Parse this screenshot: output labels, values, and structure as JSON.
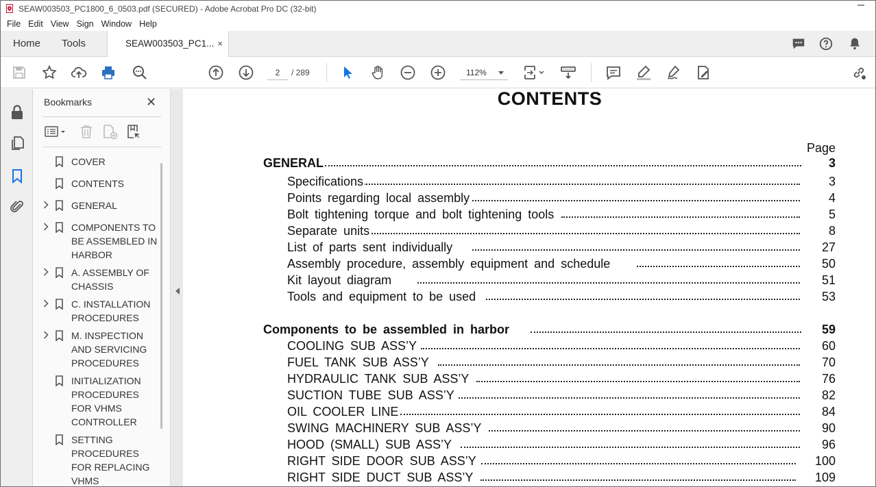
{
  "window": {
    "title": "SEAW003503_PC1800_6_0503.pdf (SECURED) - Adobe Acrobat Pro DC (32-bit)"
  },
  "menu": [
    "File",
    "Edit",
    "View",
    "Sign",
    "Window",
    "Help"
  ],
  "tabs": {
    "home": "Home",
    "tools": "Tools",
    "document": "SEAW003503_PC1...",
    "close": "×"
  },
  "toolbar": {
    "current_page": "2",
    "page_total": "/ 289",
    "zoom": "112%"
  },
  "bookmarks": {
    "title": "Bookmarks",
    "close": "✕",
    "items": [
      {
        "label": "COVER",
        "expandable": false
      },
      {
        "label": "CONTENTS",
        "expandable": false
      },
      {
        "label": "GENERAL",
        "expandable": true
      },
      {
        "label": "COMPONENTS TO BE ASSEMBLED IN HARBOR",
        "expandable": true
      },
      {
        "label": "A. ASSEMBLY OF CHASSIS",
        "expandable": true
      },
      {
        "label": "C. INSTALLATION PROCEDURES",
        "expandable": true
      },
      {
        "label": "M. INSPECTION AND SERVICING PROCEDURES",
        "expandable": true
      },
      {
        "label": "INITIALIZATION PROCEDURES FOR VHMS CONTROLLER",
        "expandable": false
      },
      {
        "label": "SETTING PROCEDURES FOR REPLACING VHMS",
        "expandable": false
      }
    ]
  },
  "document": {
    "title": "CONTENTS",
    "page_header": "Page",
    "toc": [
      {
        "text": "GENERAL",
        "page": "3",
        "level": 0
      },
      {
        "text": "Specifications",
        "page": "3",
        "level": 1
      },
      {
        "text": "Points regarding local assembly",
        "page": "4",
        "level": 1
      },
      {
        "text": "Bolt tightening torque and bolt tightening tools",
        "page": "5",
        "level": 1
      },
      {
        "text": "Separate units",
        "page": "8",
        "level": 1
      },
      {
        "text": "List of parts sent individually",
        "page": "27",
        "level": 1
      },
      {
        "text": "Assembly procedure, assembly equipment and schedule",
        "page": "50",
        "level": 1
      },
      {
        "text": "Kit layout diagram",
        "page": "51",
        "level": 1
      },
      {
        "text": "Tools and equipment to be used",
        "page": "53",
        "level": 1
      },
      {
        "text": "Components to be assembled in harbor",
        "page": "59",
        "level": 0
      },
      {
        "text": "COOLING SUB ASS’Y",
        "page": "60",
        "level": 1
      },
      {
        "text": "FUEL TANK SUB ASS’Y",
        "page": "70",
        "level": 1
      },
      {
        "text": "HYDRAULIC TANK SUB ASS’Y",
        "page": "76",
        "level": 1
      },
      {
        "text": "SUCTION TUBE SUB ASS’Y",
        "page": "82",
        "level": 1
      },
      {
        "text": "OIL COOLER LINE",
        "page": "84",
        "level": 1
      },
      {
        "text": "SWING MACHINERY SUB ASS’Y",
        "page": "90",
        "level": 1
      },
      {
        "text": "HOOD (SMALL) SUB ASS’Y",
        "page": "96",
        "level": 1
      },
      {
        "text": "RIGHT SIDE DOOR SUB ASS’Y",
        "page": "100",
        "level": 1
      },
      {
        "text": "RIGHT SIDE DUCT SUB ASS’Y",
        "page": "109",
        "level": 1
      }
    ]
  },
  "colors": {
    "accent_blue": "#1473e6",
    "print_blue": "#2b6fc0",
    "acrobat_red": "#c8102e",
    "icon_gray": "#555555"
  }
}
